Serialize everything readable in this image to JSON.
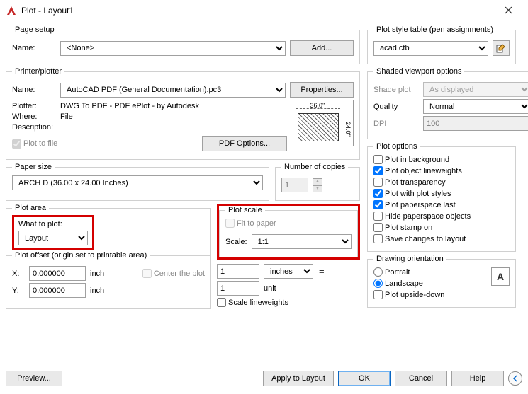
{
  "window": {
    "title": "Plot - Layout1"
  },
  "pageSetup": {
    "legend": "Page setup",
    "nameLabel": "Name:",
    "name": "<None>",
    "addBtn": "Add..."
  },
  "printer": {
    "legend": "Printer/plotter",
    "nameLabel": "Name:",
    "name": "AutoCAD PDF (General Documentation).pc3",
    "propsBtn": "Properties...",
    "plotterLabel": "Plotter:",
    "plotter": "DWG To PDF - PDF ePlot - by Autodesk",
    "whereLabel": "Where:",
    "where": "File",
    "descLabel": "Description:",
    "plotToFile": "Plot to file",
    "pdfOptions": "PDF Options...",
    "previewW": "36.0''",
    "previewH": "24.0''"
  },
  "paperSize": {
    "legend": "Paper size",
    "value": "ARCH D (36.00 x 24.00 Inches)"
  },
  "copies": {
    "legend": "Number of copies",
    "value": "1"
  },
  "plotArea": {
    "legend": "Plot area",
    "whatToPlot": "What to plot:",
    "value": "Layout"
  },
  "plotScale": {
    "legend": "Plot scale",
    "fitToPaper": "Fit to paper",
    "scaleLabel": "Scale:",
    "scale": "1:1",
    "one": "1",
    "inches": "inches",
    "one2": "1",
    "unit": "unit",
    "scaleLW": "Scale lineweights"
  },
  "plotOffset": {
    "legend": "Plot offset (origin set to printable area)",
    "xLabel": "X:",
    "x": "0.000000",
    "yLabel": "Y:",
    "y": "0.000000",
    "inch": "inch",
    "center": "Center the plot"
  },
  "styleTable": {
    "legend": "Plot style table (pen assignments)",
    "value": "acad.ctb"
  },
  "shaded": {
    "legend": "Shaded viewport options",
    "shadePlotLabel": "Shade plot",
    "shadePlot": "As displayed",
    "qualityLabel": "Quality",
    "quality": "Normal",
    "dpiLabel": "DPI",
    "dpi": "100"
  },
  "plotOptions": {
    "legend": "Plot options",
    "bg": "Plot in background",
    "lw": "Plot object lineweights",
    "trans": "Plot transparency",
    "styles": "Plot with plot styles",
    "paperspace": "Plot paperspace last",
    "hide": "Hide paperspace objects",
    "stamp": "Plot stamp on",
    "save": "Save changes to layout"
  },
  "orientation": {
    "legend": "Drawing orientation",
    "portrait": "Portrait",
    "landscape": "Landscape",
    "upside": "Plot upside-down",
    "icon": "A"
  },
  "footer": {
    "preview": "Preview...",
    "apply": "Apply to Layout",
    "ok": "OK",
    "cancel": "Cancel",
    "help": "Help"
  }
}
